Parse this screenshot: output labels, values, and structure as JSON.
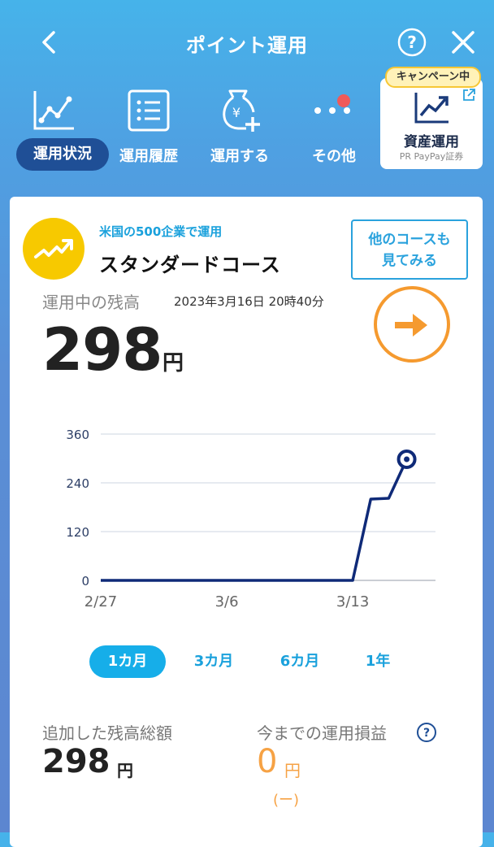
{
  "header": {
    "title": "ポイント運用",
    "back_icon": "chevron-left-icon",
    "help_icon": "question-circle-icon",
    "close_icon": "close-icon"
  },
  "nav": {
    "items": [
      {
        "label": "運用状況",
        "icon": "line-chart-icon",
        "active": true
      },
      {
        "label": "運用履歴",
        "icon": "list-icon",
        "active": false
      },
      {
        "label": "運用する",
        "icon": "yen-bag-plus-icon",
        "active": false
      },
      {
        "label": "その他",
        "icon": "more-dots-icon",
        "active": false
      }
    ],
    "campaign": {
      "badge": "キャンペーン中",
      "label": "資産運用",
      "sub": "PR PayPay証券"
    }
  },
  "course": {
    "subtitle": "米国の500企業で運用",
    "name": "スタンダードコース",
    "other_button_line1": "他のコースも",
    "other_button_line2": "見てみる"
  },
  "balance": {
    "label": "運用中の残高",
    "date": "2023年3月16日 20時40分",
    "amount": "298",
    "unit": "円"
  },
  "chart_data": {
    "type": "line",
    "x_labels": [
      "2/27",
      "3/6",
      "3/13"
    ],
    "x": [
      "2/27",
      "2/28",
      "3/1",
      "3/2",
      "3/3",
      "3/4",
      "3/5",
      "3/6",
      "3/7",
      "3/8",
      "3/9",
      "3/10",
      "3/11",
      "3/12",
      "3/13",
      "3/14",
      "3/15",
      "3/16"
    ],
    "y": [
      0,
      0,
      0,
      0,
      0,
      0,
      0,
      0,
      0,
      0,
      0,
      0,
      0,
      0,
      0,
      200,
      202,
      298
    ],
    "y_ticks": [
      "360",
      "240",
      "120",
      "0"
    ],
    "ylim": [
      0,
      360
    ],
    "grid": true,
    "colors": {
      "line": "#0f2a78",
      "grid": "#d8dde6",
      "marker": "#0f2a78"
    }
  },
  "periods": [
    {
      "label": "1カ月",
      "active": true
    },
    {
      "label": "3カ月",
      "active": false
    },
    {
      "label": "6カ月",
      "active": false
    },
    {
      "label": "1年",
      "active": false
    }
  ],
  "summary": {
    "added_label": "追加した残高総額",
    "added_amount": "298",
    "added_unit": "円",
    "pl_label": "今までの運用損益",
    "pl_amount": "0",
    "pl_unit": "円",
    "pl_change": "(ー)"
  },
  "colors": {
    "accent": "#16aee9",
    "orange": "#f59a2f",
    "nav_active": "#1f4f96",
    "course_icon": "#f7c900"
  }
}
